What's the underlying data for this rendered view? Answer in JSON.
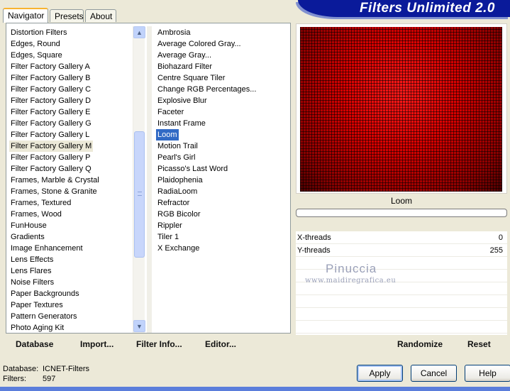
{
  "tabs": [
    {
      "label": "Navigator",
      "active": true
    },
    {
      "label": "Presets",
      "active": false
    },
    {
      "label": "About",
      "active": false
    }
  ],
  "banner": {
    "title": "Filters Unlimited 2.0"
  },
  "categories": [
    "Distortion Filters",
    "Edges, Round",
    "Edges, Square",
    "Filter Factory Gallery A",
    "Filter Factory Gallery B",
    "Filter Factory Gallery C",
    "Filter Factory Gallery D",
    "Filter Factory Gallery E",
    "Filter Factory Gallery G",
    "Filter Factory Gallery L",
    "Filter Factory Gallery M",
    "Filter Factory Gallery P",
    "Filter Factory Gallery Q",
    "Frames, Marble & Crystal",
    "Frames, Stone & Granite",
    "Frames, Textured",
    "Frames, Wood",
    "FunHouse",
    "Gradients",
    "Image Enhancement",
    "Lens Effects",
    "Lens Flares",
    "Noise Filters",
    "Paper Backgrounds",
    "Paper Textures",
    "Pattern Generators",
    "Photo Aging Kit"
  ],
  "selected_category_index": 10,
  "filters": [
    "Ambrosia",
    "Average Colored Gray...",
    "Average Gray...",
    "Biohazard Filter",
    "Centre Square Tiler",
    "Change RGB Percentages...",
    "Explosive Blur",
    "Faceter",
    "Instant Frame",
    "Loom",
    "Motion Trail",
    "Pearl's Girl",
    "Picasso's Last Word",
    "Plaidophenia",
    "RadiaLoom",
    "Refractor",
    "RGB Bicolor",
    "Rippler",
    "Tiler 1",
    "X Exchange"
  ],
  "selected_filter_index": 9,
  "left_buttons": {
    "database": "Database",
    "import": "Import...",
    "filter_info": "Filter Info...",
    "editor": "Editor..."
  },
  "preview": {
    "filter_name": "Loom",
    "progress": 0
  },
  "params": [
    {
      "label": "X-threads",
      "value": "0"
    },
    {
      "label": "Y-threads",
      "value": "255"
    }
  ],
  "right_buttons": {
    "randomize": "Randomize",
    "reset": "Reset"
  },
  "watermark": {
    "line1": "Pinuccia",
    "line2": "www.maidiregrafica.eu"
  },
  "status": {
    "database_label": "Database:",
    "database_value": "ICNET-Filters",
    "filters_label": "Filters:",
    "filters_value": "597"
  },
  "dialog_buttons": {
    "apply": "Apply",
    "cancel": "Cancel",
    "help": "Help"
  },
  "colors": {
    "banner": "#0a1a9a",
    "selection": "#316ac5",
    "preview_red": "#d80000"
  }
}
